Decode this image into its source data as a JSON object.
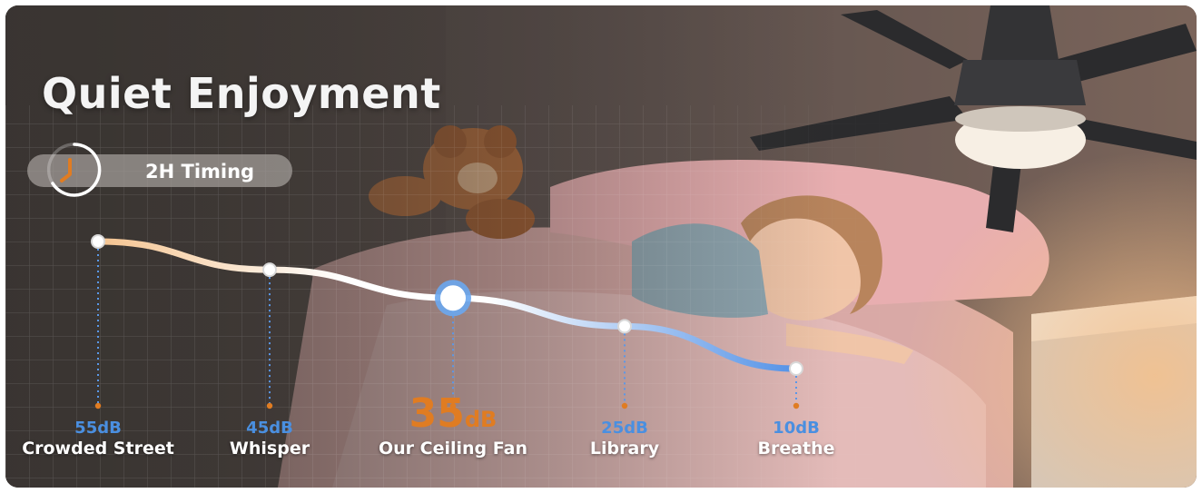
{
  "title": "Quiet Enjoyment",
  "timing_badge": {
    "label": "2H Timing",
    "icon": "timer-icon"
  },
  "colors": {
    "accent_orange": "#e07c22",
    "accent_blue": "#4a8fe0"
  },
  "chart_data": {
    "type": "line",
    "categories": [
      "Crowded Street",
      "Whisper",
      "Our Ceiling Fan",
      "Library",
      "Breathe"
    ],
    "values": [
      55,
      45,
      35,
      25,
      10
    ],
    "value_labels": [
      "55dB",
      "45dB",
      "35dB",
      "25dB",
      "10dB"
    ],
    "highlight": {
      "category": "Our Ceiling Fan",
      "number": "35",
      "unit": "dB"
    },
    "grid": true
  }
}
